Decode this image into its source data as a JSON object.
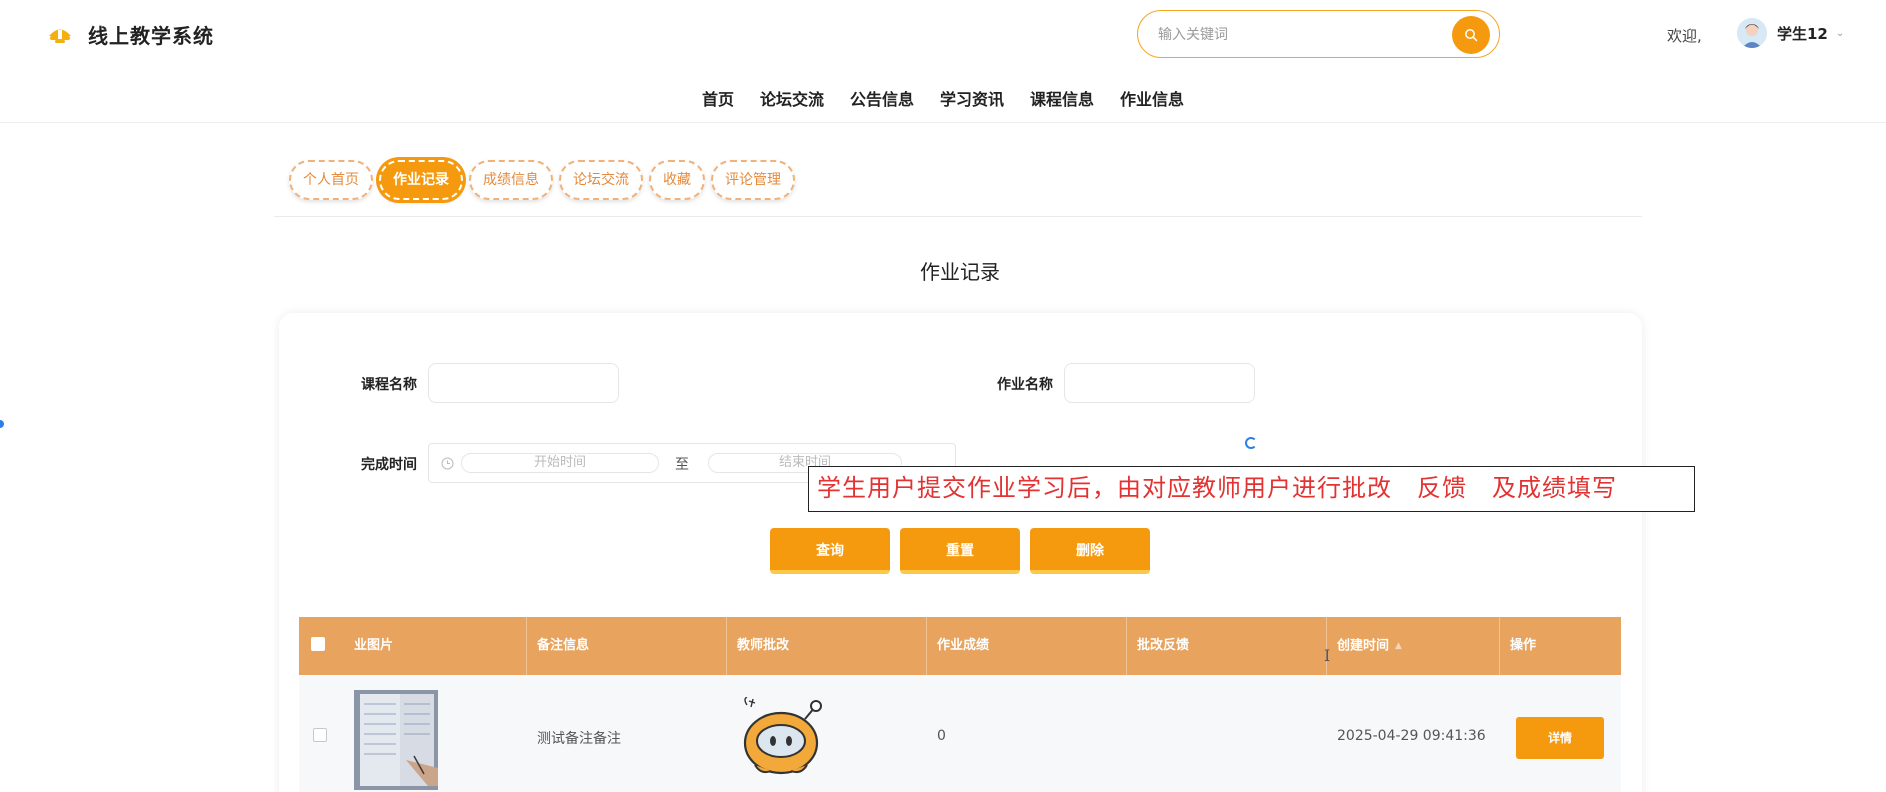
{
  "header": {
    "app_title": "线上教学系统",
    "search_placeholder": "输入关键词",
    "welcome": "欢迎,",
    "user_name": "学生12"
  },
  "nav": [
    "首页",
    "论坛交流",
    "公告信息",
    "学习资讯",
    "课程信息",
    "作业信息"
  ],
  "tabs": [
    "个人首页",
    "作业记录",
    "成绩信息",
    "论坛交流",
    "收藏",
    "评论管理"
  ],
  "active_tab": "作业记录",
  "page_title": "作业记录",
  "filters": {
    "course_label": "课程名称",
    "homework_label": "作业名称",
    "time_label": "完成时间",
    "start_placeholder": "开始时间",
    "end_placeholder": "结束时间",
    "range_sep": "至"
  },
  "buttons": {
    "query": "查询",
    "reset": "重置",
    "delete": "删除"
  },
  "annotation": "学生用户提交作业学习后，由对应教师用户进行批改　反馈　及成绩填写",
  "table": {
    "columns": [
      "业图片",
      "备注信息",
      "教师批改",
      "作业成绩",
      "批改反馈",
      "创建时间",
      "操作"
    ],
    "rows": [
      {
        "note": "测试备注备注",
        "score": "0",
        "feedback": "",
        "created": "2025-04-29 09:41:36",
        "action": "详情"
      }
    ]
  },
  "colors": {
    "accent": "#f59a0e",
    "table_header": "#e8a45e",
    "annotation_text": "#e33232"
  }
}
